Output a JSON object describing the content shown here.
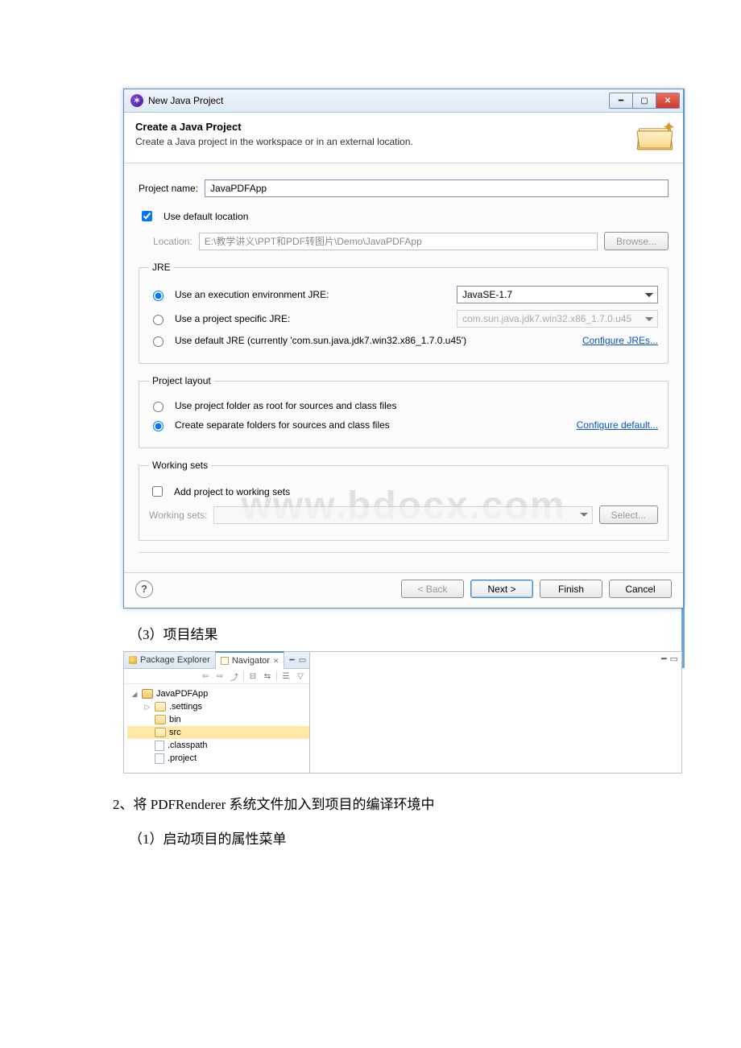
{
  "dialog": {
    "title": "New Java Project",
    "banner": {
      "heading": "Create a Java Project",
      "sub": "Create a Java project in the workspace or in an external location."
    },
    "projectNameLabel": "Project name:",
    "projectNameValue": "JavaPDFApp",
    "useDefaultLocationLabel": "Use default location",
    "locationLabel": "Location:",
    "locationValue": "E:\\教学讲义\\PPT和PDF转图片\\Demo\\JavaPDFApp",
    "browseLabel": "Browse...",
    "jre": {
      "legend": "JRE",
      "opt1": "Use an execution environment JRE:",
      "opt1val": "JavaSE-1.7",
      "opt2": "Use a project specific JRE:",
      "opt2val": "com.sun.java.jdk7.win32.x86_1.7.0.u45",
      "opt3": "Use default JRE (currently 'com.sun.java.jdk7.win32.x86_1.7.0.u45')",
      "configure": "Configure JREs..."
    },
    "layout": {
      "legend": "Project layout",
      "opt1": "Use project folder as root for sources and class files",
      "opt2": "Create separate folders for sources and class files",
      "configure": "Configure default..."
    },
    "wsets": {
      "legend": "Working sets",
      "add": "Add project to working sets",
      "label": "Working sets:",
      "select": "Select..."
    },
    "footer": {
      "back": "< Back",
      "next": "Next >",
      "finish": "Finish",
      "cancel": "Cancel"
    }
  },
  "watermark": "www.bdocx.com",
  "doc": {
    "line1": "（3）项目结果",
    "line2": "2、将 PDFRenderer 系统文件加入到项目的编译环境中",
    "line3": "（1）启动项目的属性菜单"
  },
  "navigator": {
    "tab1": "Package Explorer",
    "tab2": "Navigator",
    "tree": {
      "n0": "JavaPDFApp",
      "n1": ".settings",
      "n2": "bin",
      "n3": "src",
      "n4": ".classpath",
      "n5": ".project"
    }
  }
}
